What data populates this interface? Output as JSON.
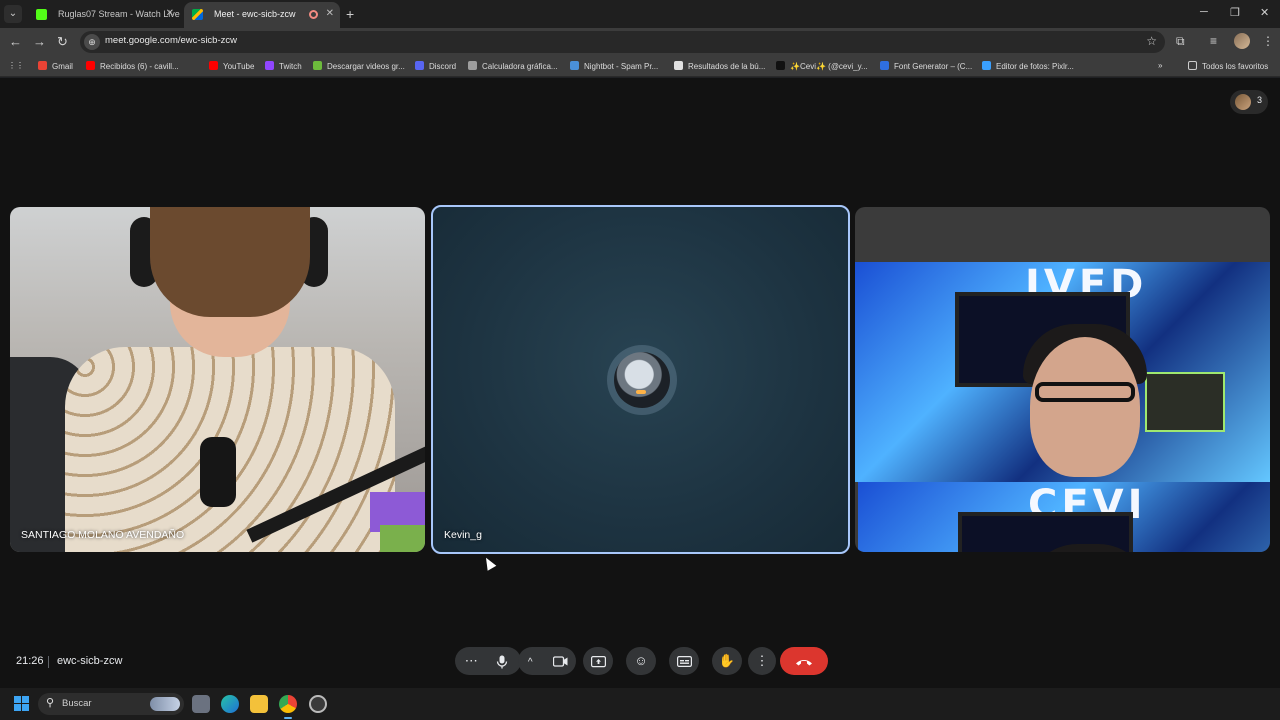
{
  "browser": {
    "tabs": [
      {
        "title": "Ruglas07 Stream - Watch Live o",
        "close": "✕"
      },
      {
        "title": "Meet - ewc-sicb-zcw",
        "close": "✕"
      }
    ],
    "new_tab": "+",
    "url": "meet.google.com/ewc-sicb-zcw",
    "bookmarks": [
      {
        "label": "Gmail",
        "color": "#ea4335"
      },
      {
        "label": "Recibidos (6) - cavill...",
        "color": "#ff0000"
      },
      {
        "label": "YouTube",
        "color": "#ff0000"
      },
      {
        "label": "Twitch",
        "color": "#9146ff"
      },
      {
        "label": "Descargar videos gr...",
        "color": "#6dbb3c"
      },
      {
        "label": "Discord",
        "color": "#5865f2"
      },
      {
        "label": "Calculadora gráfica...",
        "color": "#9e9e9e"
      },
      {
        "label": "Nightbot - Spam Pr...",
        "color": "#4a90d9"
      },
      {
        "label": "Resultados de la bú...",
        "color": "#e0e0e0"
      },
      {
        "label": "✨Cevi✨ (@cevi_y...",
        "color": "#111111"
      },
      {
        "label": "Font Generator – (C...",
        "color": "#2f6fe0"
      },
      {
        "label": "Editor de fotos: Pixlr...",
        "color": "#3aa0ff"
      }
    ],
    "bookmarks_more": "»",
    "all_bookmarks": "Todos los favoritos"
  },
  "meet": {
    "participant_count": "3",
    "participants": [
      {
        "name": "SANTIAGO MOLANO AVENDAÑO"
      },
      {
        "name": "Kevin_g"
      }
    ],
    "tile3_letters_top": "IVED",
    "tile3_letters_bottom": "CEVI",
    "time": "21:26",
    "meeting_code": "ewc-sicb-zcw"
  },
  "taskbar": {
    "search_placeholder": "Buscar"
  },
  "colors": {
    "accent_border": "#a8c7fa",
    "end_call": "#dc362e",
    "control_bg": "#333537"
  }
}
